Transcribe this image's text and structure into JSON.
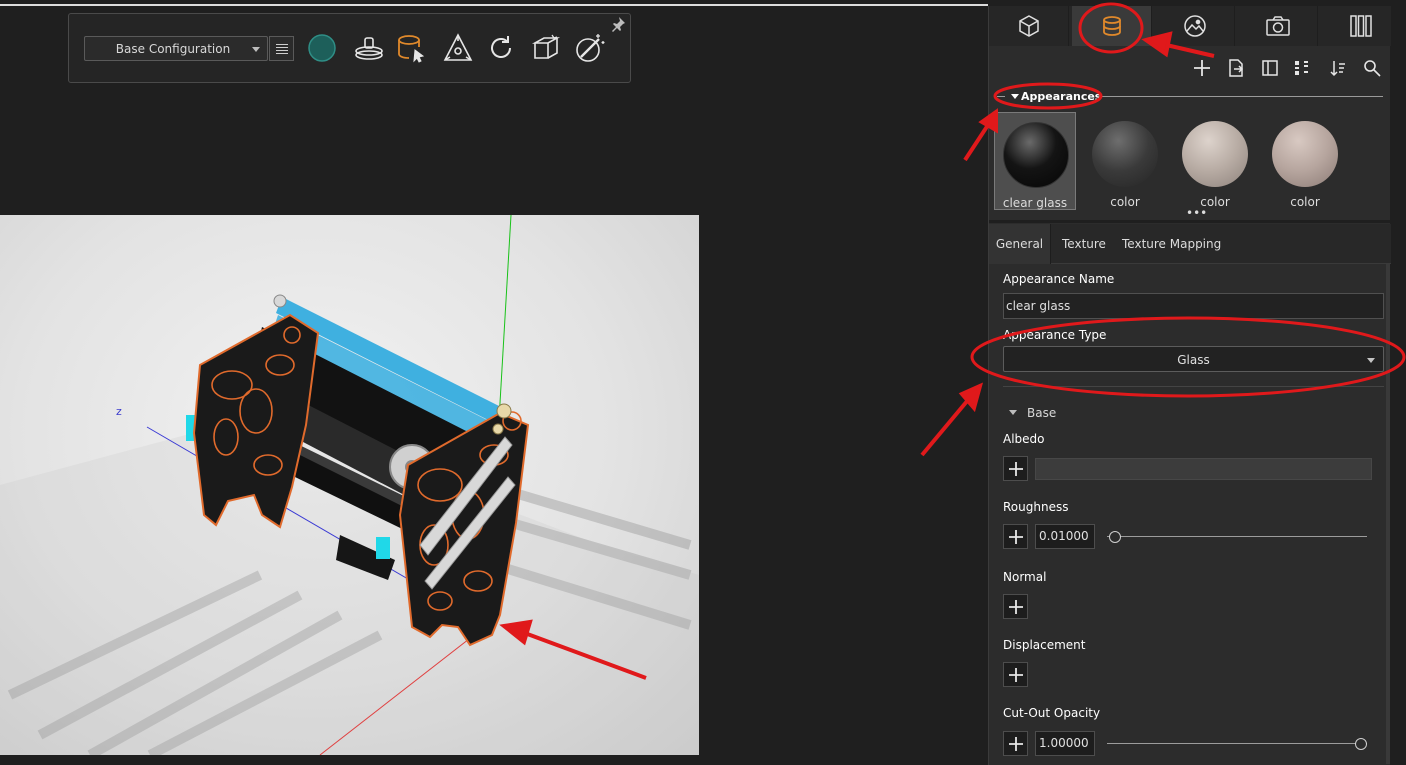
{
  "toolbar": {
    "configuration": "Base Configuration",
    "icons": [
      "list-icon",
      "environment-sphere-icon",
      "turntable-icon",
      "material-assign-icon",
      "move-gizmo-icon",
      "refresh-icon",
      "box-icon",
      "magic-wand-icon",
      "pin-icon"
    ]
  },
  "viewport": {
    "axis_label": "z"
  },
  "panel": {
    "tabs": [
      "model-icon",
      "appearance-icon",
      "environment-icon",
      "camera-icon",
      "library-icon"
    ],
    "active_tab": "appearance",
    "tools": [
      "add-icon",
      "import-icon",
      "panel-icon",
      "grid-icon",
      "sort-icon",
      "search-icon"
    ],
    "section_title": "Appearances",
    "appearances": [
      {
        "name": "clear glass",
        "selected": true,
        "color": "#0d0d0d"
      },
      {
        "name": "color",
        "selected": false,
        "color": "#3a3a3a"
      },
      {
        "name": "color",
        "selected": false,
        "color": "#b7aba3"
      },
      {
        "name": "color",
        "selected": false,
        "color": "#b6a59e"
      }
    ],
    "sub_tabs": [
      "General",
      "Texture",
      "Texture Mapping"
    ],
    "active_sub_tab": "General",
    "appearance_name_label": "Appearance Name",
    "appearance_name_value": "clear glass",
    "appearance_type_label": "Appearance Type",
    "appearance_type_value": "Glass",
    "base_group": "Base",
    "albedo_label": "Albedo",
    "roughness_label": "Roughness",
    "roughness_value": "0.01000",
    "roughness_level": 0.01,
    "normal_label": "Normal",
    "displacement_label": "Displacement",
    "cutout_label": "Cut-Out Opacity",
    "cutout_value": "1.00000",
    "cutout_level": 1.0
  },
  "colors": {
    "accent": "#e0892b",
    "annotation": "#e0191b",
    "panel_bg": "#2c2c2c"
  }
}
